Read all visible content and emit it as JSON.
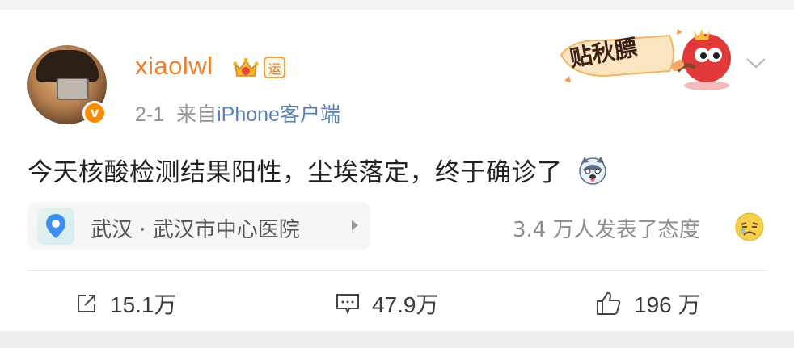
{
  "post": {
    "username": "xiaolwl",
    "badge_yun": "运",
    "verified_mark": "v",
    "date": "2-1",
    "source_prefix": "来自",
    "source": "iPhone客户端",
    "text": "今天核酸检测结果阳性，尘埃落定，终于确诊了",
    "sticker_text": "贴秋膘"
  },
  "location": {
    "label": "武汉 · 武汉市中心医院"
  },
  "reactions": {
    "summary": "3.4 万人发表了态度"
  },
  "actions": {
    "repost": "15.1万",
    "comment": "47.9万",
    "like": "196 万"
  },
  "icons": {
    "avatar": "user-avatar",
    "verified": "verified-badge-icon",
    "crown": "crown-icon",
    "dropdown": "chevron-down-icon",
    "location": "location-pin-icon",
    "repost": "share-icon",
    "comment": "comment-icon",
    "like": "thumbs-up-icon"
  },
  "colors": {
    "username": "#ef7f2a",
    "source_link": "#5a82b8",
    "verified": "#ff8a00"
  }
}
